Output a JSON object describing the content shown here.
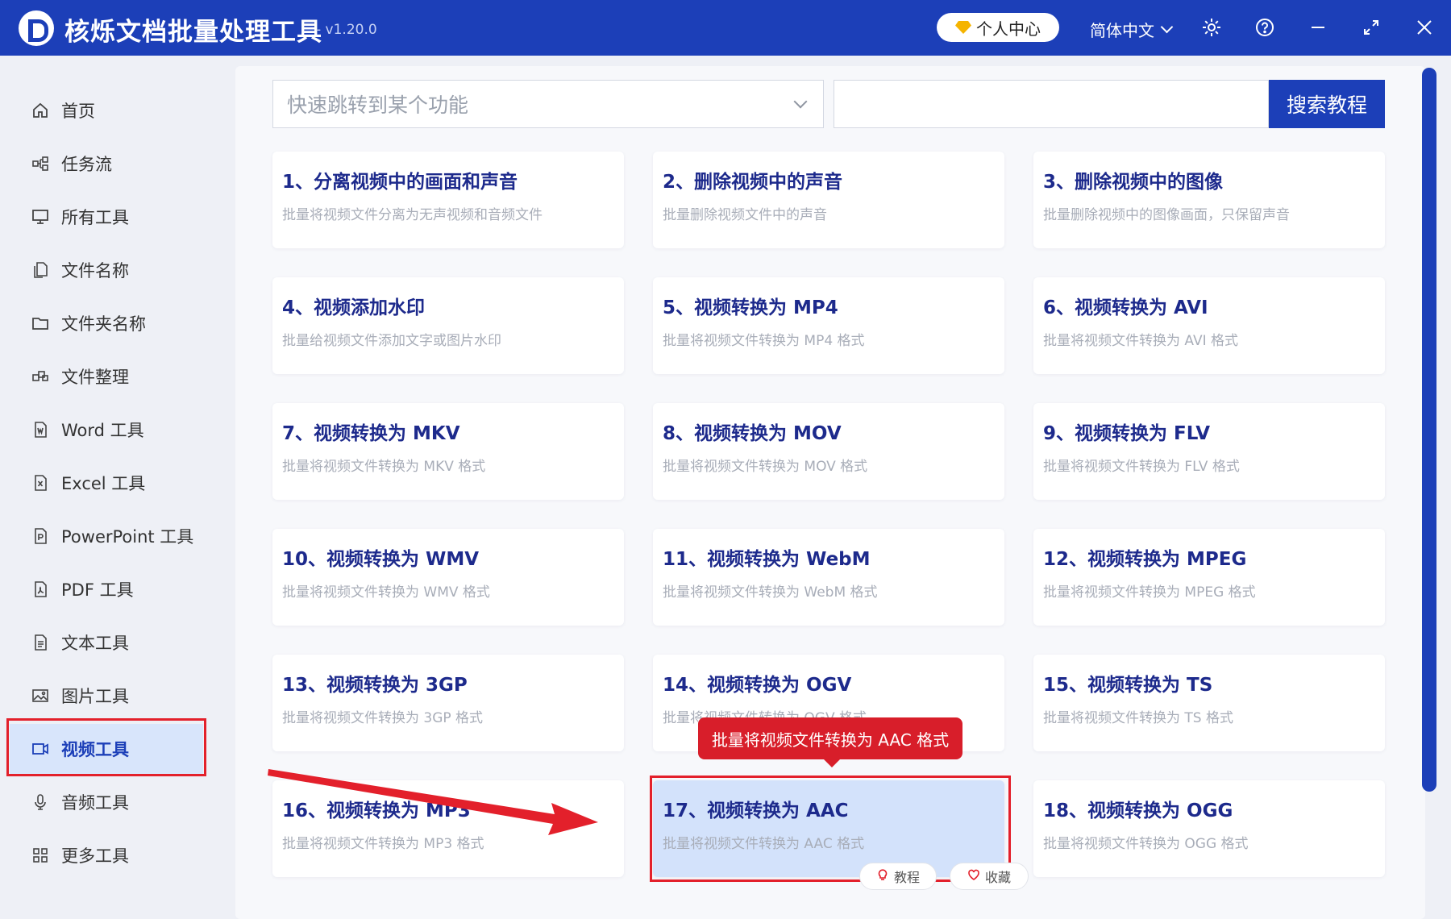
{
  "app": {
    "title": "核烁文档批量处理工具",
    "version": "- v1.20.0"
  },
  "titlebar": {
    "vip_label": "个人中心",
    "language": "简体中文"
  },
  "sidebar": {
    "items": [
      {
        "label": "首页",
        "icon": "home-icon"
      },
      {
        "label": "任务流",
        "icon": "workflow-icon"
      },
      {
        "label": "所有工具",
        "icon": "monitor-icon"
      },
      {
        "label": "文件名称",
        "icon": "file-copy-icon"
      },
      {
        "label": "文件夹名称",
        "icon": "folder-icon"
      },
      {
        "label": "文件整理",
        "icon": "organize-icon"
      },
      {
        "label": "Word 工具",
        "icon": "word-icon"
      },
      {
        "label": "Excel 工具",
        "icon": "excel-icon"
      },
      {
        "label": "PowerPoint 工具",
        "icon": "powerpoint-icon"
      },
      {
        "label": "PDF 工具",
        "icon": "pdf-icon"
      },
      {
        "label": "文本工具",
        "icon": "text-icon"
      },
      {
        "label": "图片工具",
        "icon": "image-icon"
      },
      {
        "label": "视频工具",
        "icon": "video-icon"
      },
      {
        "label": "音频工具",
        "icon": "microphone-icon"
      },
      {
        "label": "更多工具",
        "icon": "grid-icon"
      }
    ],
    "active": "视频工具"
  },
  "toolbar": {
    "jump_placeholder": "快速跳转到某个功能",
    "search_label": "搜索教程"
  },
  "tools": [
    {
      "title": "1、分离视频中的画面和声音",
      "desc": "批量将视频文件分离为无声视频和音频文件"
    },
    {
      "title": "2、删除视频中的声音",
      "desc": "批量删除视频文件中的声音"
    },
    {
      "title": "3、删除视频中的图像",
      "desc": "批量删除视频中的图像画面，只保留声音"
    },
    {
      "title": "4、视频添加水印",
      "desc": "批量给视频文件添加文字或图片水印"
    },
    {
      "title": "5、视频转换为 MP4",
      "desc": "批量将视频文件转换为 MP4 格式"
    },
    {
      "title": "6、视频转换为 AVI",
      "desc": "批量将视频文件转换为 AVI 格式"
    },
    {
      "title": "7、视频转换为 MKV",
      "desc": "批量将视频文件转换为 MKV 格式"
    },
    {
      "title": "8、视频转换为 MOV",
      "desc": "批量将视频文件转换为 MOV 格式"
    },
    {
      "title": "9、视频转换为 FLV",
      "desc": "批量将视频文件转换为 FLV 格式"
    },
    {
      "title": "10、视频转换为 WMV",
      "desc": "批量将视频文件转换为 WMV 格式"
    },
    {
      "title": "11、视频转换为 WebM",
      "desc": "批量将视频文件转换为 WebM 格式"
    },
    {
      "title": "12、视频转换为 MPEG",
      "desc": "批量将视频文件转换为 MPEG 格式"
    },
    {
      "title": "13、视频转换为 3GP",
      "desc": "批量将视频文件转换为 3GP 格式"
    },
    {
      "title": "14、视频转换为 OGV",
      "desc": "批量将视频文件转换为 OGV 格式"
    },
    {
      "title": "15、视频转换为 TS",
      "desc": "批量将视频文件转换为 TS 格式"
    },
    {
      "title": "16、视频转换为 MP3",
      "desc": "批量将视频文件转换为 MP3 格式"
    },
    {
      "title": "17、视频转换为 AAC",
      "desc": "批量将视频文件转换为 AAC 格式"
    },
    {
      "title": "18、视频转换为 OGG",
      "desc": "批量将视频文件转换为 OGG 格式"
    }
  ],
  "selected_tool": "17、视频转换为 AAC",
  "tooltip": "批量将视频文件转换为 AAC 格式",
  "card_actions": {
    "tutorial": "教程",
    "favorite": "收藏"
  },
  "colors": {
    "brand": "#1c3fb8",
    "highlight": "#e3202b",
    "title_text": "#1d2a8c",
    "selected_card": "#d3e2fb"
  }
}
